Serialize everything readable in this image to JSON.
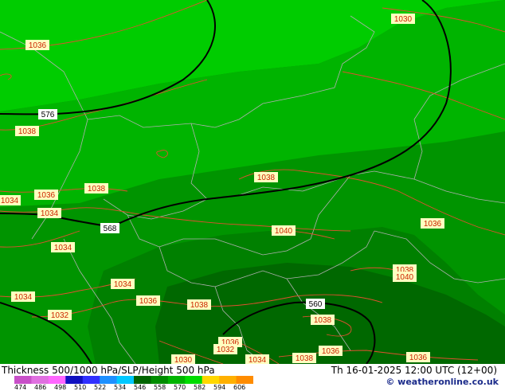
{
  "map": {
    "pressure_labels": [
      {
        "text": "1036"
      },
      {
        "text": "1030"
      },
      {
        "text": "1038"
      },
      {
        "text": "1034"
      },
      {
        "text": "1036"
      },
      {
        "text": "1038"
      },
      {
        "text": "1034"
      },
      {
        "text": "1038"
      },
      {
        "text": "1034"
      },
      {
        "text": "1040"
      },
      {
        "text": "1036"
      },
      {
        "text": "1038"
      },
      {
        "text": "1040"
      },
      {
        "text": "1034"
      },
      {
        "text": "1034"
      },
      {
        "text": "1032"
      },
      {
        "text": "1036"
      },
      {
        "text": "1038"
      },
      {
        "text": "1038"
      },
      {
        "text": "1036"
      },
      {
        "text": "1032"
      },
      {
        "text": "1030"
      },
      {
        "text": "1034"
      },
      {
        "text": "1038"
      },
      {
        "text": "1036"
      },
      {
        "text": "1036"
      }
    ],
    "height_labels": [
      {
        "text": "576"
      },
      {
        "text": "568"
      },
      {
        "text": "560"
      }
    ]
  },
  "footer": {
    "title": "Thickness 500/1000 hPa/SLP/Height 500 hPa",
    "datetime": "Th 16-01-2025 12:00 UTC (12+00)",
    "credit": "© weatheronline.co.uk",
    "colorbar_ticks": [
      "474",
      "486",
      "498",
      "510",
      "522",
      "534",
      "546",
      "558",
      "570",
      "582",
      "594",
      "606"
    ],
    "colorbar_colors": [
      "#c850c8",
      "#e070e0",
      "#ff66ff",
      "#1010c0",
      "#3030ff",
      "#1e90ff",
      "#00c8ff",
      "#006400",
      "#008c00",
      "#00b400",
      "#00dc00",
      "#ffd700",
      "#ffb000",
      "#ff8c00"
    ]
  }
}
